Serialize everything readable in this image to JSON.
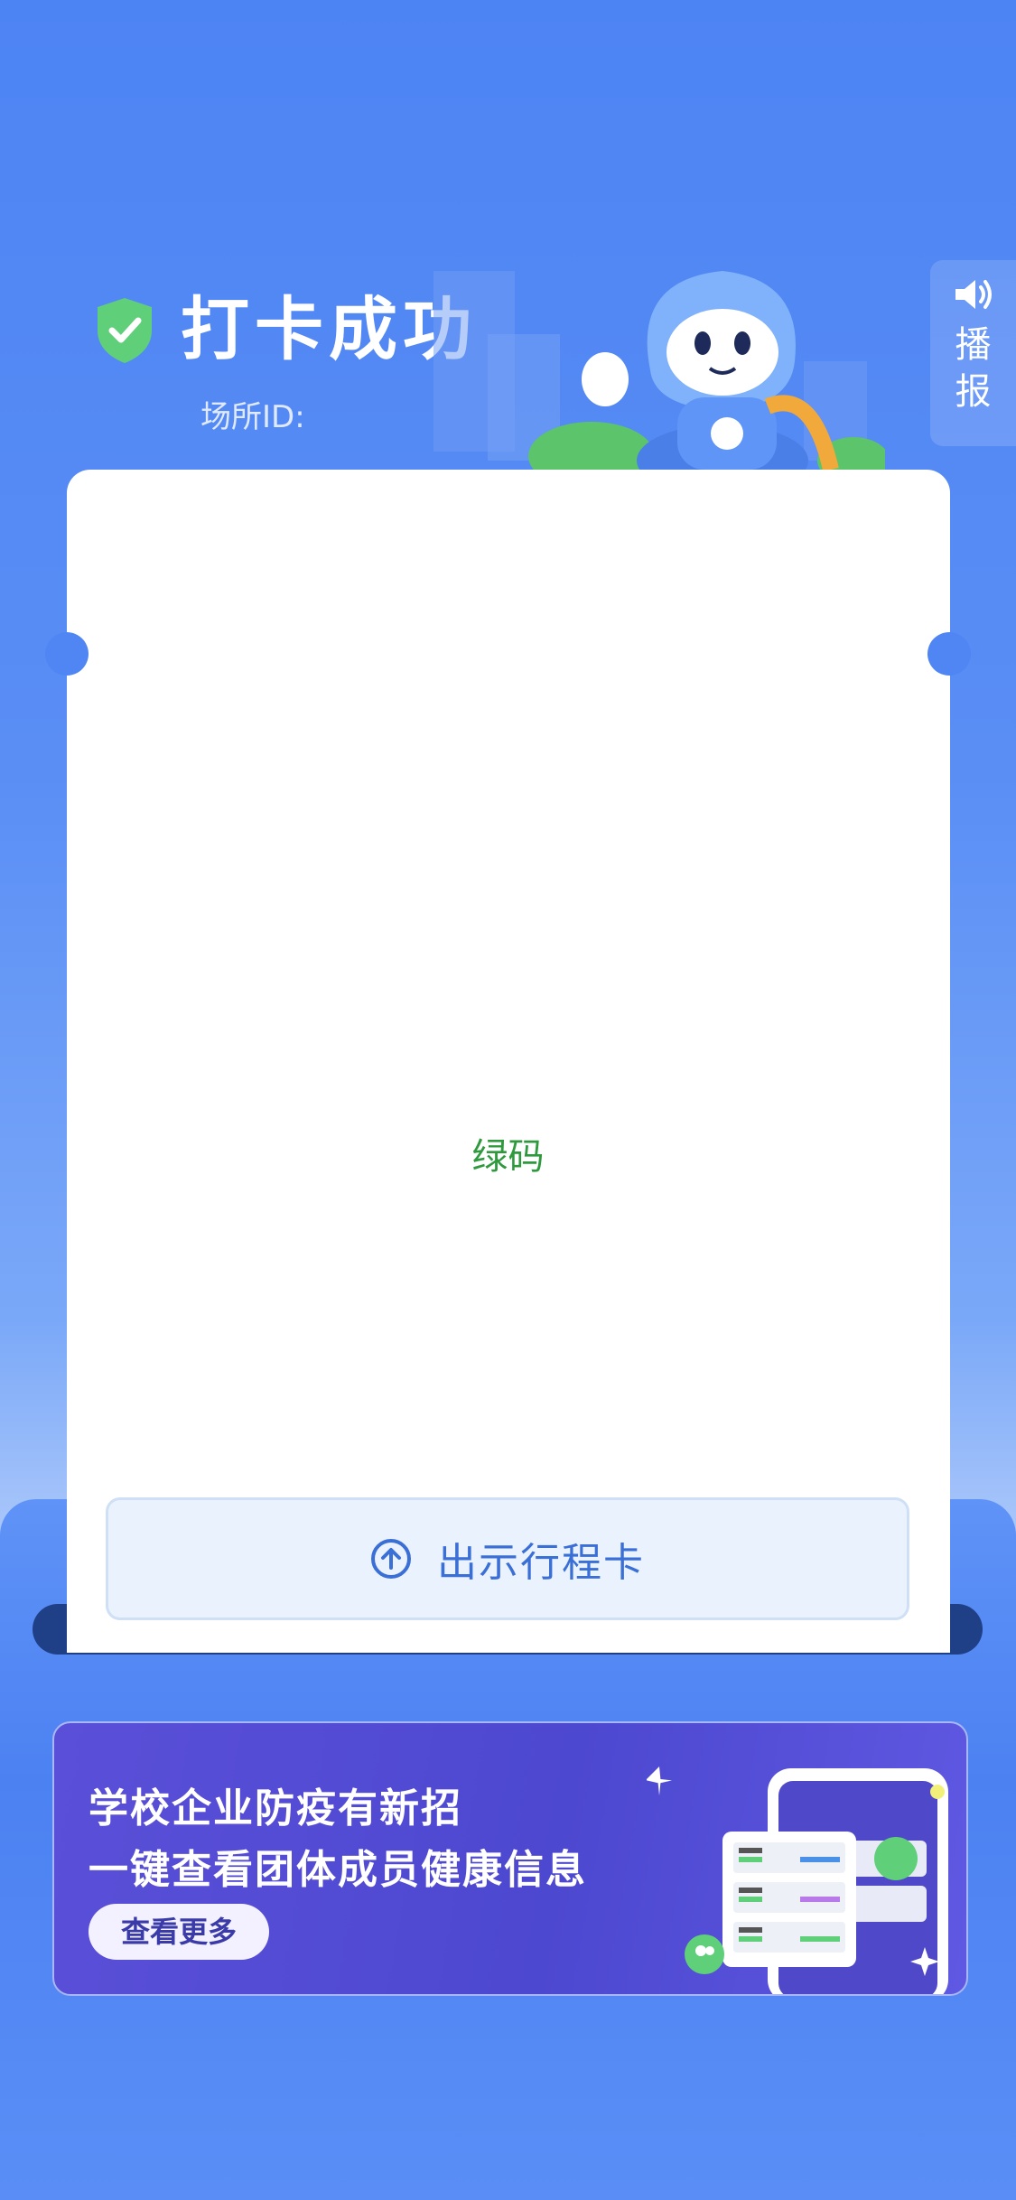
{
  "header": {
    "title": "打卡成功",
    "venue_label": "场所ID:"
  },
  "broadcast": {
    "label": "播报"
  },
  "card": {
    "code_label": "绿码",
    "show_button_label": "出示行程卡"
  },
  "banner": {
    "line1": "学校企业防疫有新招",
    "line2": "一键查看团体成员健康信息",
    "more_label": "查看更多"
  },
  "colors": {
    "brand_blue": "#4f86f4",
    "success_green": "#2e9a3d",
    "button_text": "#3a6fd6"
  }
}
